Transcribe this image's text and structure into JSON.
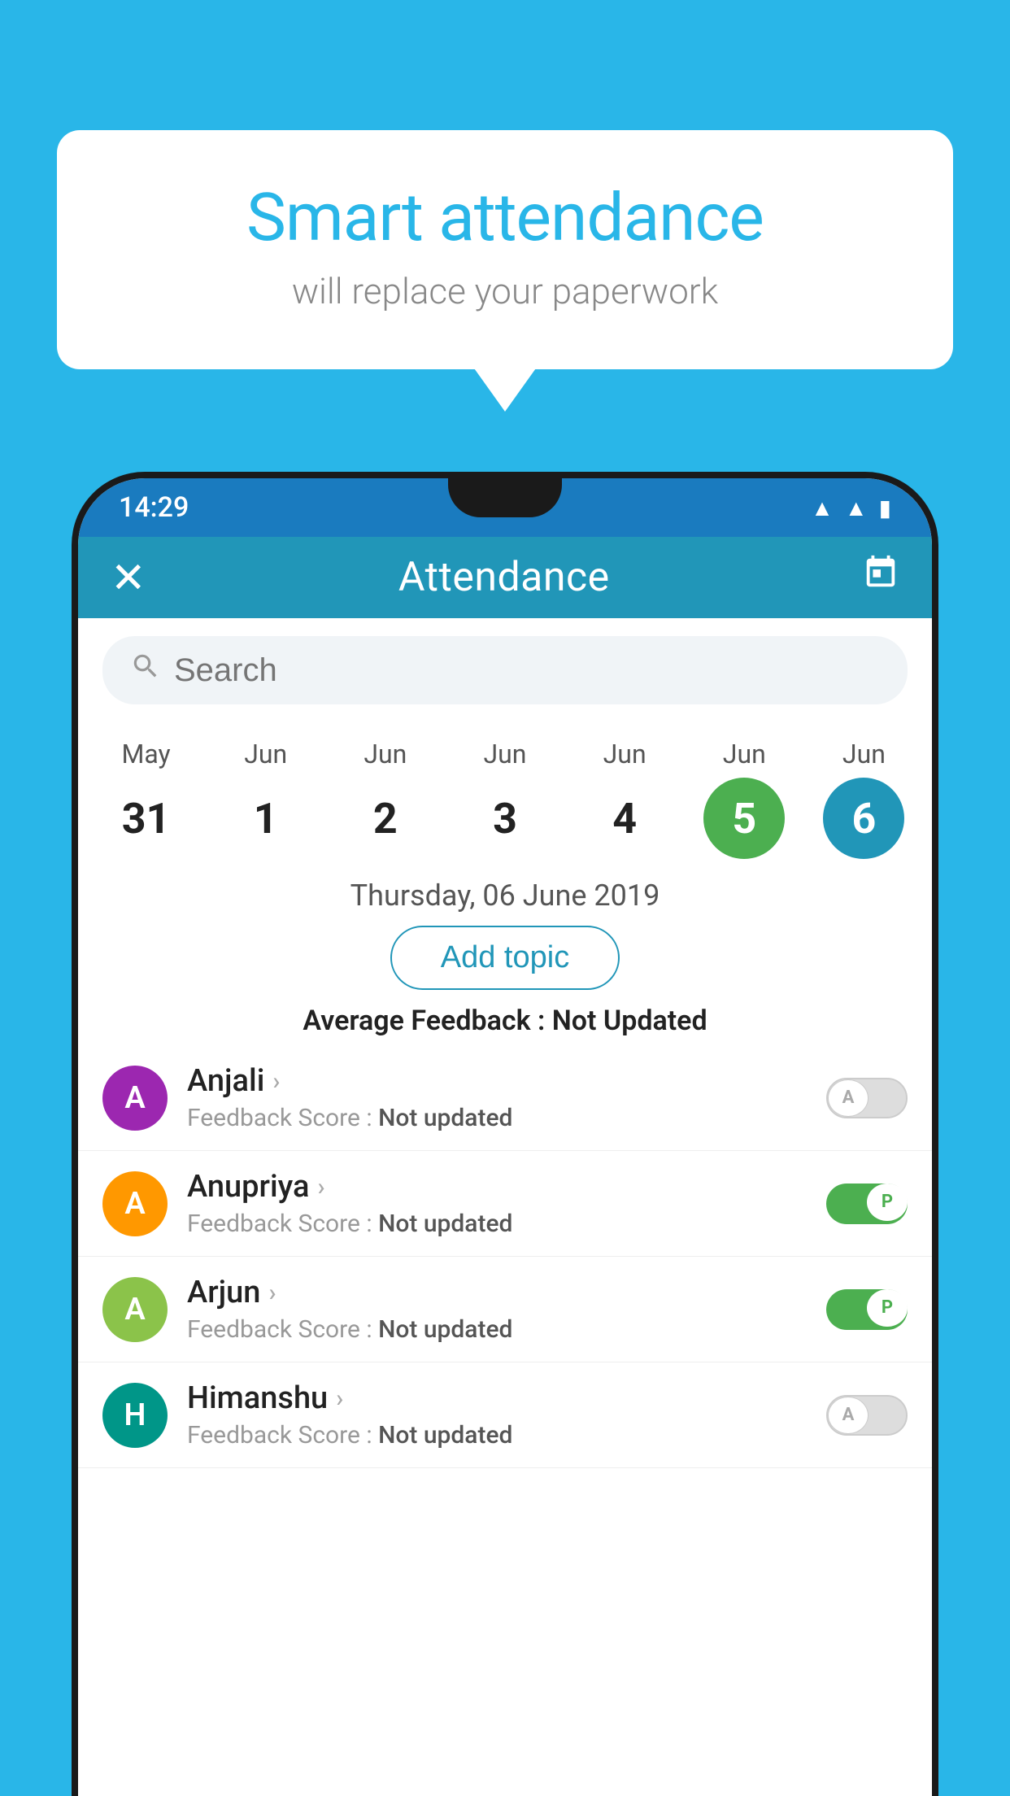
{
  "background_color": "#29b6e8",
  "bubble": {
    "title": "Smart attendance",
    "subtitle": "will replace your paperwork"
  },
  "status_bar": {
    "time": "14:29",
    "icons": [
      "wifi",
      "signal",
      "battery"
    ]
  },
  "app_bar": {
    "title": "Attendance",
    "close_label": "✕",
    "calendar_label": "📅"
  },
  "search": {
    "placeholder": "Search"
  },
  "calendar": {
    "days": [
      {
        "month": "May",
        "date": "31",
        "highlight": ""
      },
      {
        "month": "Jun",
        "date": "1",
        "highlight": ""
      },
      {
        "month": "Jun",
        "date": "2",
        "highlight": ""
      },
      {
        "month": "Jun",
        "date": "3",
        "highlight": ""
      },
      {
        "month": "Jun",
        "date": "4",
        "highlight": ""
      },
      {
        "month": "Jun",
        "date": "5",
        "highlight": "green"
      },
      {
        "month": "Jun",
        "date": "6",
        "highlight": "blue"
      }
    ]
  },
  "selected_date": "Thursday, 06 June 2019",
  "add_topic_label": "Add topic",
  "avg_feedback_label": "Average Feedback : ",
  "avg_feedback_value": "Not Updated",
  "students": [
    {
      "name": "Anjali",
      "avatar_letter": "A",
      "avatar_color": "purple",
      "feedback": "Not updated",
      "toggle": "off",
      "toggle_label": "A"
    },
    {
      "name": "Anupriya",
      "avatar_letter": "A",
      "avatar_color": "orange",
      "feedback": "Not updated",
      "toggle": "on",
      "toggle_label": "P"
    },
    {
      "name": "Arjun",
      "avatar_letter": "A",
      "avatar_color": "lightgreen",
      "feedback": "Not updated",
      "toggle": "on",
      "toggle_label": "P"
    },
    {
      "name": "Himanshu",
      "avatar_letter": "H",
      "avatar_color": "teal",
      "feedback": "Not updated",
      "toggle": "off",
      "toggle_label": "A"
    }
  ],
  "feedback_score_prefix": "Feedback Score : "
}
